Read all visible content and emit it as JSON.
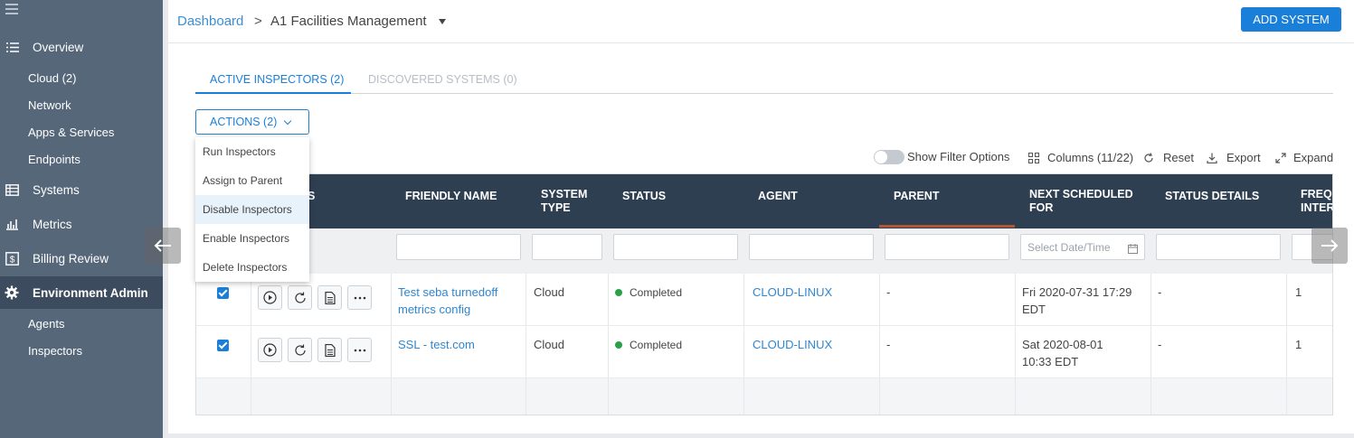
{
  "sidebar": {
    "items": [
      {
        "label": "Overview",
        "icon": "list-check-icon"
      },
      {
        "label": "Cloud (2)"
      },
      {
        "label": "Network"
      },
      {
        "label": "Apps & Services"
      },
      {
        "label": "Endpoints"
      },
      {
        "label": "Systems",
        "icon": "table-icon"
      },
      {
        "label": "Metrics",
        "icon": "bar-chart-icon"
      },
      {
        "label": "Billing Review",
        "icon": "dollar-icon"
      },
      {
        "label": "Environment Admin",
        "icon": "gear-icon",
        "active": true
      },
      {
        "label": "Agents"
      },
      {
        "label": "Inspectors"
      }
    ]
  },
  "breadcrumb": {
    "link": "Dashboard",
    "separator": ">",
    "current": "A1 Facilities Management"
  },
  "header": {
    "add_button": "ADD SYSTEM"
  },
  "tabs": [
    {
      "label": "ACTIVE INSPECTORS (2)",
      "active": true
    },
    {
      "label": "DISCOVERED SYSTEMS (0)",
      "active": false
    }
  ],
  "actions": {
    "label": "ACTIONS (2)",
    "menu": [
      "Run Inspectors",
      "Assign to Parent",
      "Disable Inspectors",
      "Enable Inspectors",
      "Delete Inspectors"
    ],
    "hovered": "Disable Inspectors"
  },
  "toolbar": {
    "filter_toggle": "Show Filter Options",
    "columns": "Columns (11/22)",
    "reset": "Reset",
    "export": "Export",
    "expand": "Expand"
  },
  "table": {
    "headers": [
      "S",
      "FRIENDLY NAME",
      "SYSTEM TYPE",
      "STATUS",
      "AGENT",
      "PARENT",
      "NEXT SCHEDULED FOR",
      "STATUS DETAILS",
      "FREQ INTER"
    ],
    "date_placeholder": "Select Date/Time",
    "rows": [
      {
        "name": "Test seba turnedoff metrics config",
        "type": "Cloud",
        "status": "Completed",
        "agent": "CLOUD-LINUX",
        "parent": "-",
        "next": "Fri 2020-07-31 17:29 EDT",
        "details": "-",
        "freq": "1"
      },
      {
        "name": "SSL - test.com",
        "type": "Cloud",
        "status": "Completed",
        "agent": "CLOUD-LINUX",
        "parent": "-",
        "next": "Sat 2020-08-01 10:33 EDT",
        "details": "-",
        "freq": "1"
      }
    ]
  },
  "colors": {
    "accent": "#1a7fd9",
    "sidebar": "#56677a",
    "table_header": "#2f3f52",
    "status_ok": "#2aa04a"
  }
}
